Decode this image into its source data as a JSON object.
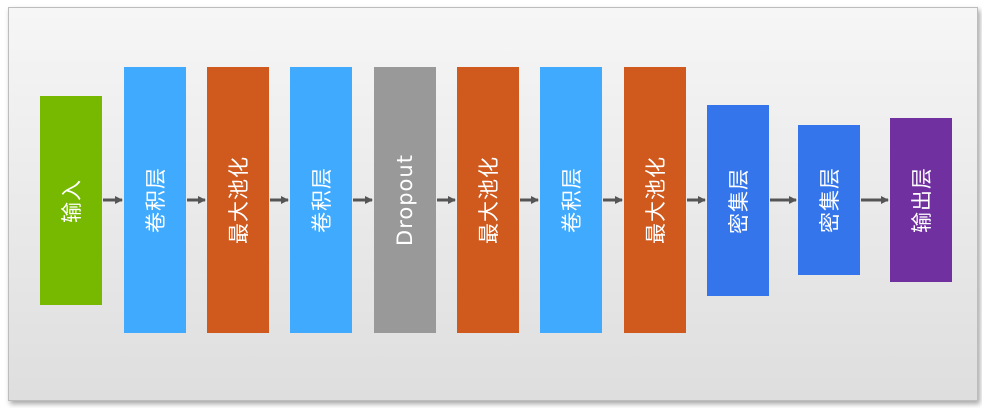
{
  "colors": {
    "input": "#76b900",
    "conv": "#40aaff",
    "pool": "#d05a1e",
    "dropout": "#999999",
    "dense": "#3575ec",
    "output": "#7030a0",
    "arrow": "#555555"
  },
  "layers": [
    {
      "label": "输入",
      "kind": "input"
    },
    {
      "label": "卷积层",
      "kind": "conv"
    },
    {
      "label": "最大池化",
      "kind": "pool"
    },
    {
      "label": "卷积层",
      "kind": "conv"
    },
    {
      "label": "Dropout",
      "kind": "dropout"
    },
    {
      "label": "最大池化",
      "kind": "pool"
    },
    {
      "label": "卷积层",
      "kind": "conv"
    },
    {
      "label": "最大池化",
      "kind": "pool"
    },
    {
      "label": "密集层",
      "kind": "dense"
    },
    {
      "label": "密集层",
      "kind": "dense"
    },
    {
      "label": "输出层",
      "kind": "output"
    }
  ]
}
